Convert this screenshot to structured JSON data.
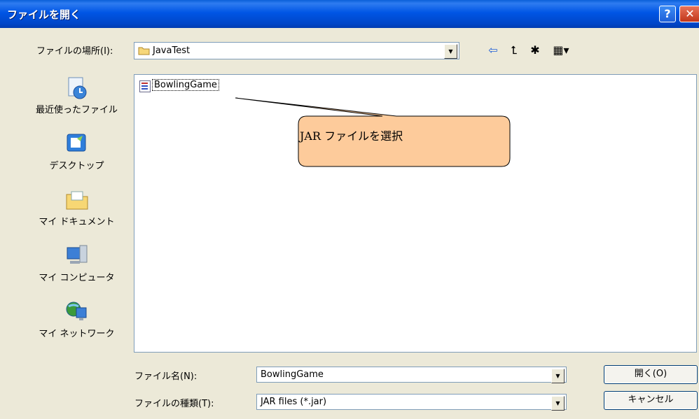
{
  "window": {
    "title": "ファイルを開く",
    "help_label": "?",
    "close_label": "✕"
  },
  "location": {
    "label": "ファイルの場所(I):",
    "value": "JavaTest"
  },
  "toolbar": {
    "back_icon": "back-arrow-icon",
    "up_icon": "up-folder-icon",
    "new_folder_icon": "new-folder-icon",
    "view_icon": "view-menu-icon",
    "back_glyph": "⇦",
    "up_glyph": "⮤",
    "new_glyph": "✱",
    "view_glyph": "▦▾"
  },
  "places": [
    {
      "label": "最近使ったファイル",
      "icon": "recent-files-icon"
    },
    {
      "label": "デスクトップ",
      "icon": "desktop-icon"
    },
    {
      "label": "マイ ドキュメント",
      "icon": "my-documents-icon"
    },
    {
      "label": "マイ コンピュータ",
      "icon": "my-computer-icon"
    },
    {
      "label": "マイ ネットワーク",
      "icon": "my-network-icon"
    }
  ],
  "files": [
    {
      "name": "BowlingGame",
      "icon": "jar-file-icon"
    }
  ],
  "callout": {
    "text": "JAR ファイルを選択"
  },
  "filename": {
    "label": "ファイル名(N):",
    "value": "BowlingGame"
  },
  "filetype": {
    "label": "ファイルの種類(T):",
    "value": "JAR files (*.jar)"
  },
  "buttons": {
    "open": "開く(O)",
    "cancel": "キャンセル"
  },
  "colors": {
    "titlebar": "#0055E5",
    "dialog_bg": "#ECE9D8",
    "callout_fill": "#FDCB9B",
    "field_border": "#7F9DB9"
  }
}
